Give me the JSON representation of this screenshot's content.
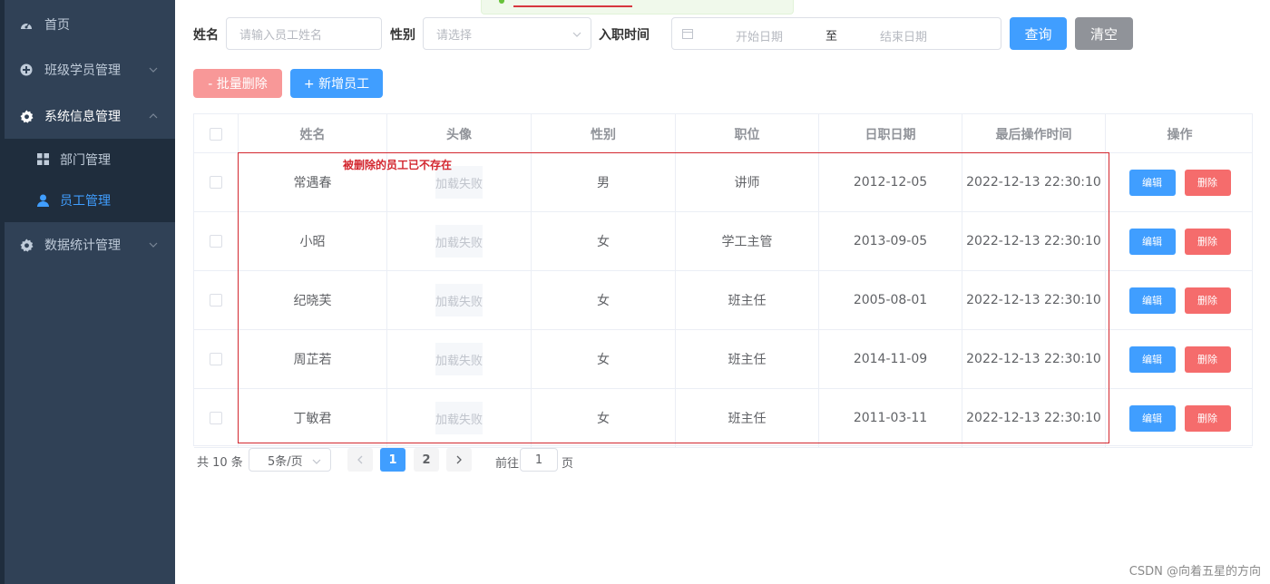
{
  "sidebar": {
    "items": [
      {
        "label": "首页",
        "icon": "dashboard-icon"
      },
      {
        "label": "班级学员管理",
        "icon": "plus-circle-icon"
      },
      {
        "label": "系统信息管理",
        "icon": "gear-icon"
      },
      {
        "label": "数据统计管理",
        "icon": "gear-icon"
      }
    ],
    "subitems": [
      {
        "label": "部门管理",
        "icon": "grid-icon"
      },
      {
        "label": "员工管理",
        "icon": "user-icon"
      }
    ],
    "active_color": "#409eff",
    "bg_color": "#304156"
  },
  "search": {
    "name_label": "姓名",
    "name_placeholder": "请输入员工姓名",
    "gender_label": "性别",
    "gender_placeholder": "请选择",
    "date_label": "入职时间",
    "start_placeholder": "开始日期",
    "range_sep": "至",
    "end_placeholder": "结束日期",
    "query_button": "查询",
    "clear_button": "清空"
  },
  "toolbar": {
    "batch_delete": "- 批量删除",
    "add_employee": "+ 新增员工"
  },
  "table": {
    "headers": [
      "姓名",
      "头像",
      "性别",
      "职位",
      "日职日期",
      "最后操作时间",
      "操作"
    ],
    "rows": [
      {
        "name": "常遇春",
        "avatar": "加载失败",
        "gender": "男",
        "job": "讲师",
        "entry": "2012-12-05",
        "updated": "2022-12-13 22:30:10"
      },
      {
        "name": "小昭",
        "avatar": "加载失败",
        "gender": "女",
        "job": "学工主管",
        "entry": "2013-09-05",
        "updated": "2022-12-13 22:30:10"
      },
      {
        "name": "纪晓芙",
        "avatar": "加载失败",
        "gender": "女",
        "job": "班主任",
        "entry": "2005-08-01",
        "updated": "2022-12-13 22:30:10"
      },
      {
        "name": "周芷若",
        "avatar": "加载失败",
        "gender": "女",
        "job": "班主任",
        "entry": "2014-11-09",
        "updated": "2022-12-13 22:30:10"
      },
      {
        "name": "丁敏君",
        "avatar": "加载失败",
        "gender": "女",
        "job": "班主任",
        "entry": "2011-03-11",
        "updated": "2022-12-13 22:30:10"
      }
    ],
    "edit_label": "编辑",
    "delete_label": "删除"
  },
  "annotation": {
    "note": "被删除的员工已不存在",
    "color": "#d3272f"
  },
  "pagination": {
    "total": "共 10 条",
    "page_size": "5条/页",
    "pages": [
      "1",
      "2"
    ],
    "current": "1",
    "goto_prefix": "前往",
    "goto_value": "1",
    "goto_suffix": "页"
  },
  "watermark": "CSDN @向着五星的方向"
}
